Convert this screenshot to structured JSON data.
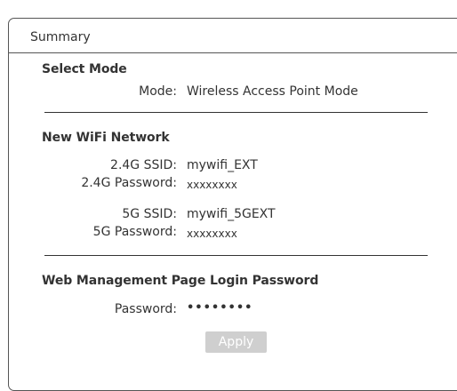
{
  "panel": {
    "title": "Summary"
  },
  "select_mode": {
    "heading": "Select Mode",
    "mode_label": "Mode:",
    "mode_value": "Wireless Access Point Mode"
  },
  "wifi": {
    "heading": "New WiFi Network",
    "ssid_24_label": "2.4G SSID:",
    "ssid_24_value": "mywifi_EXT",
    "password_24_label": "2.4G Password:",
    "password_24_value": "xxxxxxxx",
    "ssid_5_label": "5G SSID:",
    "ssid_5_value": "mywifi_5GEXT",
    "password_5_label": "5G Password:",
    "password_5_value": "xxxxxxxx"
  },
  "web_mgmt": {
    "heading": "Web Management Page Login Password",
    "password_label": "Password:",
    "password_value": "••••••••"
  },
  "actions": {
    "apply_label": "Apply",
    "apply_enabled": false
  },
  "colors": {
    "border": "#555555",
    "text": "#333333",
    "button_disabled_bg": "#cfcfcf",
    "button_text": "#ffffff"
  }
}
